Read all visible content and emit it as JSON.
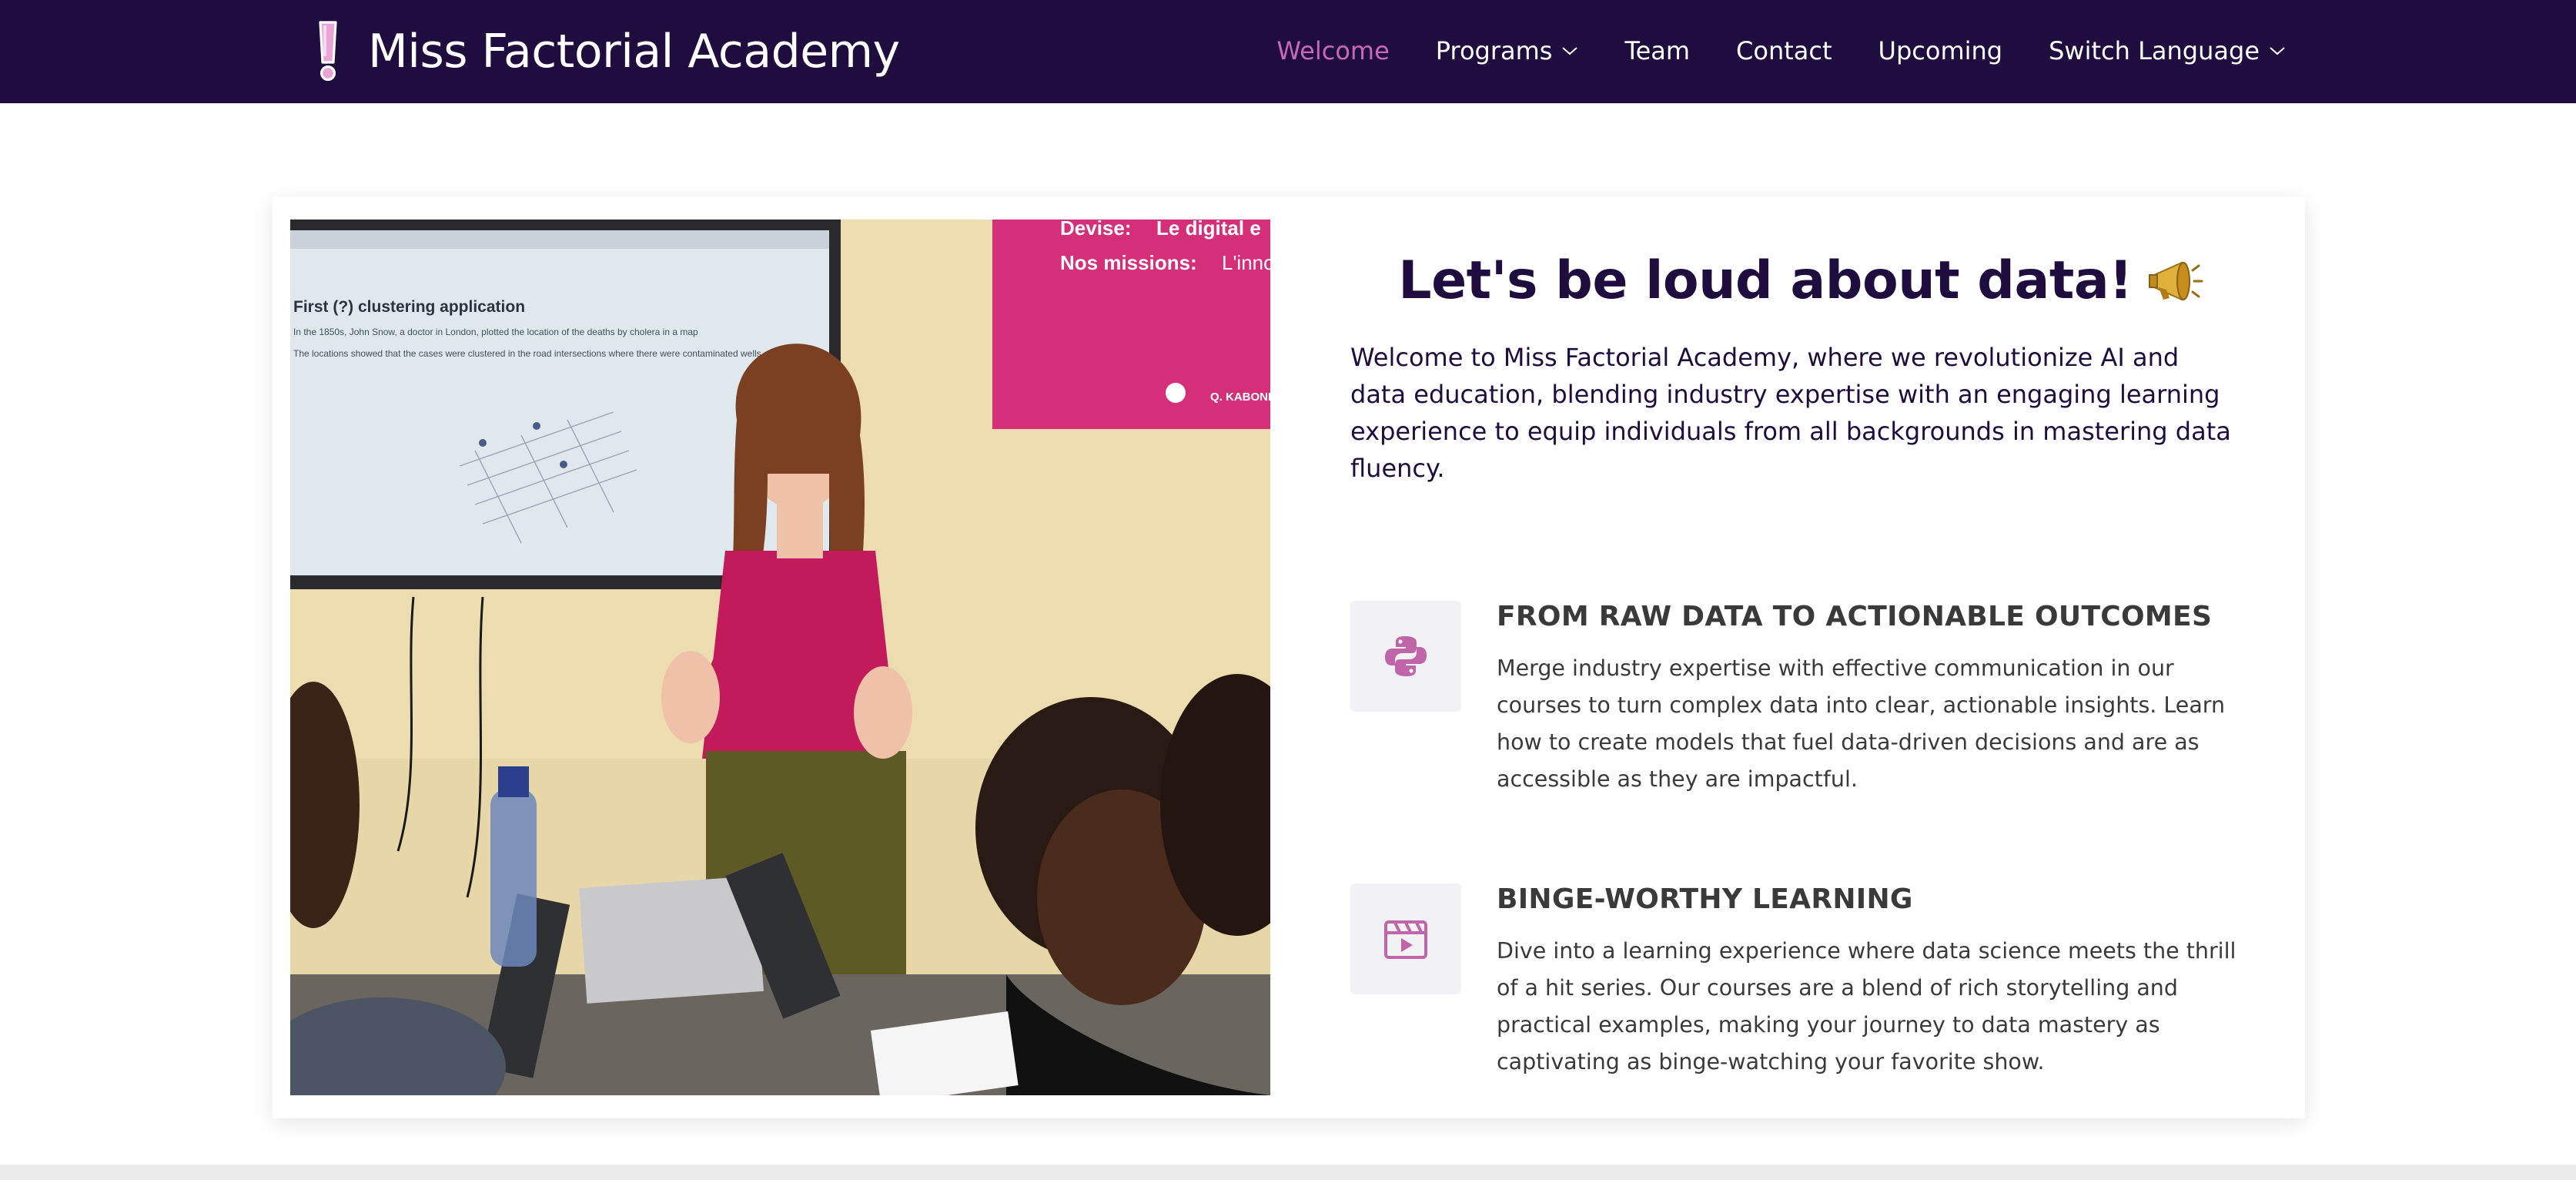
{
  "brand": {
    "name": "Miss Factorial Academy",
    "logo_icon": "exclamation-mark-icon"
  },
  "nav": {
    "items": [
      {
        "label": "Welcome",
        "active": true
      },
      {
        "label": "Programs",
        "dropdown": true
      },
      {
        "label": "Team"
      },
      {
        "label": "Contact"
      },
      {
        "label": "Upcoming"
      },
      {
        "label": "Switch Language",
        "dropdown": true
      }
    ]
  },
  "hero": {
    "headline": "Let's be loud about data!",
    "headline_icon": "megaphone-icon",
    "intro": "Welcome to Miss Factorial Academy, where we revolutionize AI and data education, blending industry expertise with an engaging learning experience to equip individuals from all backgrounds in mastering data fluency."
  },
  "photo": {
    "screen_title": "First (?) clustering application",
    "screen_bullet_1": "In the 1850s, John Snow, a doctor in London, plotted the location of the deaths by cholera in a map",
    "screen_bullet_2": "The locations showed that the cases were clustered in the road intersections where there were contaminated wells",
    "banner_line_1_label": "Devise:",
    "banner_line_1_value": "Le digital e",
    "banner_line_2_label": "Nos missions:",
    "banner_line_2_value": "L'inno",
    "banner_address": "Q. KABONDO AVENUE LA"
  },
  "features": [
    {
      "icon": "python-icon",
      "title": "FROM RAW DATA TO ACTIONABLE OUTCOMES",
      "text": "Merge industry expertise with effective communication in our courses to turn complex data into clear, actionable insights. Learn how to create models that fuel data-driven decisions and are as accessible as they are impactful."
    },
    {
      "icon": "film-icon",
      "title": "BINGE-WORTHY LEARNING",
      "text": "Dive into a learning experience where data science meets the thrill of a hit series. Our courses are a blend of rich storytelling and practical examples, making your journey to data mastery as captivating as binge-watching your favorite show."
    }
  ],
  "colors": {
    "navbar_bg": "#1e0d3e",
    "accent": "#c968b3",
    "headline": "#1e0d3e"
  }
}
